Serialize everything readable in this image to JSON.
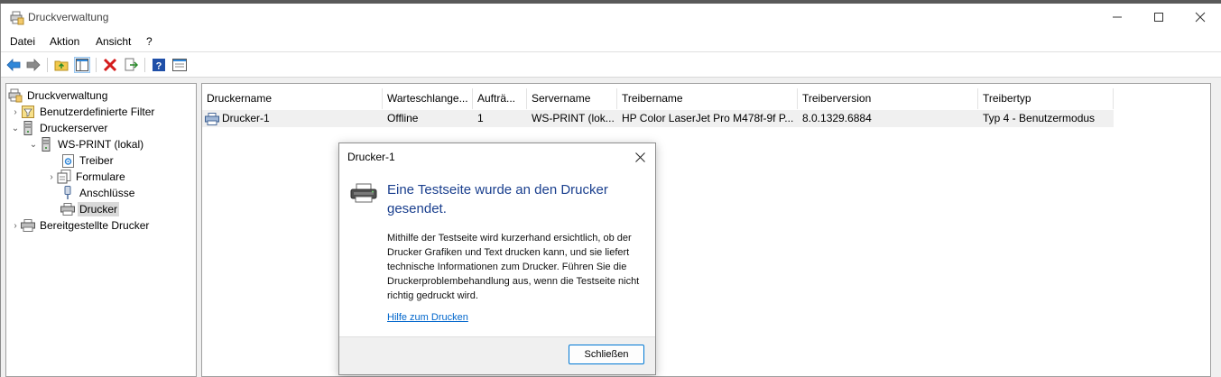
{
  "window": {
    "title": "Druckverwaltung",
    "controls": {
      "minimize": "—",
      "maximize": "☐",
      "close": "✕"
    }
  },
  "menu": [
    "Datei",
    "Aktion",
    "Ansicht",
    "?"
  ],
  "toolbar_icons": [
    "back-icon",
    "forward-icon",
    "up-folder-icon",
    "show-hide-tree-icon",
    "delete-icon",
    "export-icon",
    "help-icon",
    "properties-icon"
  ],
  "tree": {
    "items": [
      {
        "label": "Druckverwaltung",
        "icon": "print-management-icon"
      },
      {
        "label": "Benutzerdefinierte Filter",
        "icon": "filter-icon",
        "expander": "›"
      },
      {
        "label": "Druckerserver",
        "icon": "server-icon",
        "expander": "⌄"
      },
      {
        "label": "WS-PRINT (lokal)",
        "icon": "computer-icon",
        "expander": "⌄"
      },
      {
        "label": "Treiber",
        "icon": "driver-icon"
      },
      {
        "label": "Formulare",
        "icon": "forms-icon",
        "expander": "›"
      },
      {
        "label": "Anschlüsse",
        "icon": "port-icon"
      },
      {
        "label": "Drucker",
        "icon": "printer-icon",
        "selected": true
      },
      {
        "label": "Bereitgestellte Drucker",
        "icon": "printer-icon",
        "expander": "›"
      }
    ]
  },
  "list": {
    "columns": [
      "Druckername",
      "Warteschlange...",
      "Aufträ...",
      "Servername",
      "Treibername",
      "Treiberversion",
      "Treibertyp"
    ],
    "rows": [
      [
        "Drucker-1",
        "Offline",
        "1",
        "WS-PRINT (lok...",
        "HP Color LaserJet Pro M478f-9f P...",
        "8.0.1329.6884",
        "Typ 4 - Benutzermodus"
      ]
    ]
  },
  "dialog": {
    "title": "Drucker-1",
    "heading": "Eine Testseite wurde an den Drucker gesendet.",
    "body": "Mithilfe der Testseite wird kurzerhand ersichtlich, ob der Drucker Grafiken und Text drucken kann, und sie liefert technische Informationen zum Drucker. Führen Sie die Druckerproblembehandlung aus, wenn die Testseite nicht richtig gedruckt wird.",
    "link": "Hilfe zum Drucken",
    "button": "Schließen"
  },
  "colors": {
    "accent": "#0078d4",
    "heading": "#1a3f8e",
    "link": "#0066cc"
  }
}
